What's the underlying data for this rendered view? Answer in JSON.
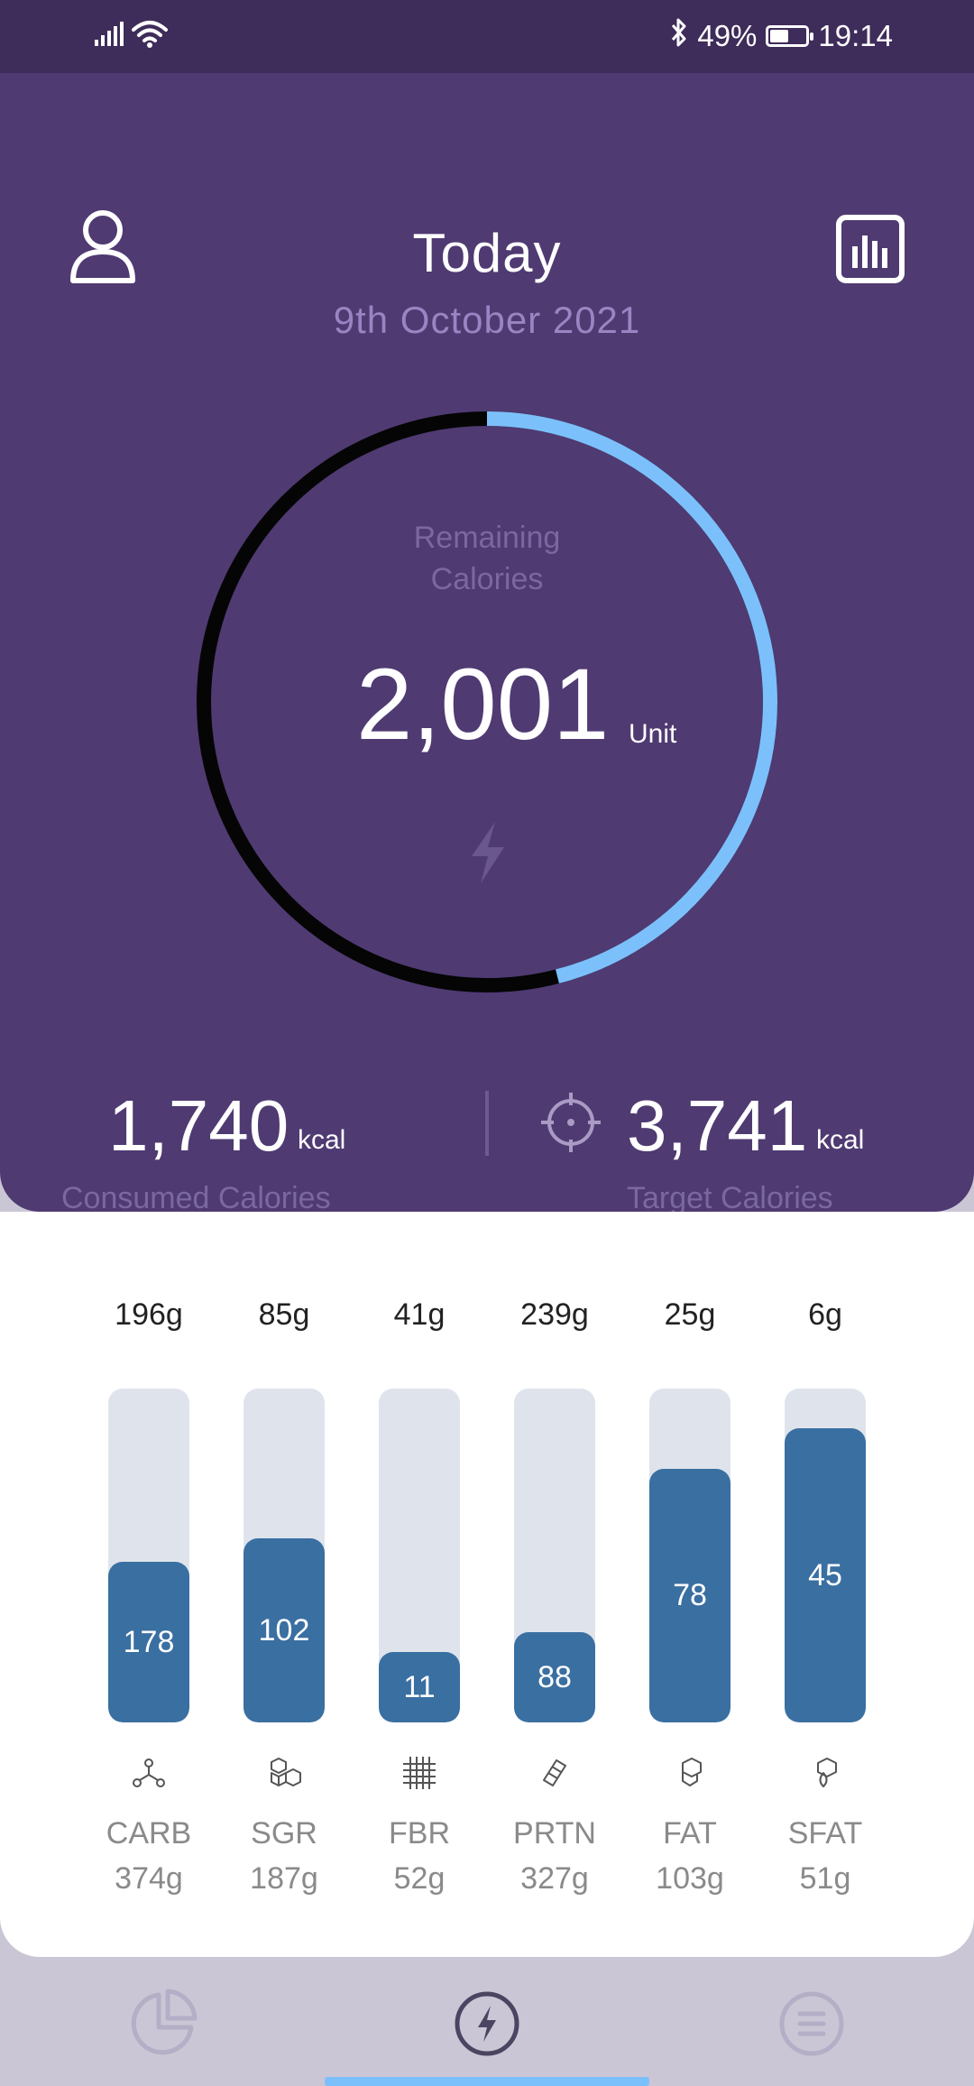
{
  "status_bar": {
    "battery": "49%",
    "battery_level": 0.49,
    "time": "19:14",
    "icons": [
      "signal-icon",
      "wifi-icon",
      "bluetooth-icon",
      "battery-icon"
    ]
  },
  "header": {
    "title": "Today",
    "date": "9th October 2021",
    "left_icon": "profile-icon",
    "right_icon": "stats-icon"
  },
  "ring": {
    "label_line1": "Remaining",
    "label_line2": "Calories",
    "value": "2,001",
    "unit": "Unit",
    "progress_fraction": 0.46,
    "progress_color": "#7cc0fb",
    "track_color": "#050505"
  },
  "summary": {
    "consumed_value": "1,740",
    "consumed_unit": "kcal",
    "consumed_label": "Consumed Calories",
    "target_value": "3,741",
    "target_unit": "kcal",
    "target_label": "Target Calories"
  },
  "nutrients": [
    {
      "top": "196g",
      "value": "178",
      "fraction": 0.48,
      "name": "CARB",
      "total": "374g",
      "icon": "molecule-icon"
    },
    {
      "top": "85g",
      "value": "102",
      "fraction": 0.55,
      "name": "SGR",
      "total": "187g",
      "icon": "sugar-cubes-icon"
    },
    {
      "top": "41g",
      "value": "11",
      "fraction": 0.21,
      "name": "FBR",
      "total": "52g",
      "icon": "fiber-grid-icon"
    },
    {
      "top": "239g",
      "value": "88",
      "fraction": 0.27,
      "name": "PRTN",
      "total": "327g",
      "icon": "protein-icon"
    },
    {
      "top": "25g",
      "value": "78",
      "fraction": 0.76,
      "name": "FAT",
      "total": "103g",
      "icon": "fat-hexagon-icon"
    },
    {
      "top": "6g",
      "value": "45",
      "fraction": 0.88,
      "name": "SFAT",
      "total": "51g",
      "icon": "saturated-fat-icon"
    }
  ],
  "colors": {
    "primary": "#4f3a72",
    "status_bar": "#3e2c5a",
    "bar_fill": "#3a6fa1",
    "bar_track": "#dfe4ec",
    "accent": "#7cc0fb"
  },
  "bottom_nav": {
    "items": [
      "pie-chart-icon",
      "bolt-icon",
      "menu-icon"
    ],
    "active": "bolt-icon"
  }
}
